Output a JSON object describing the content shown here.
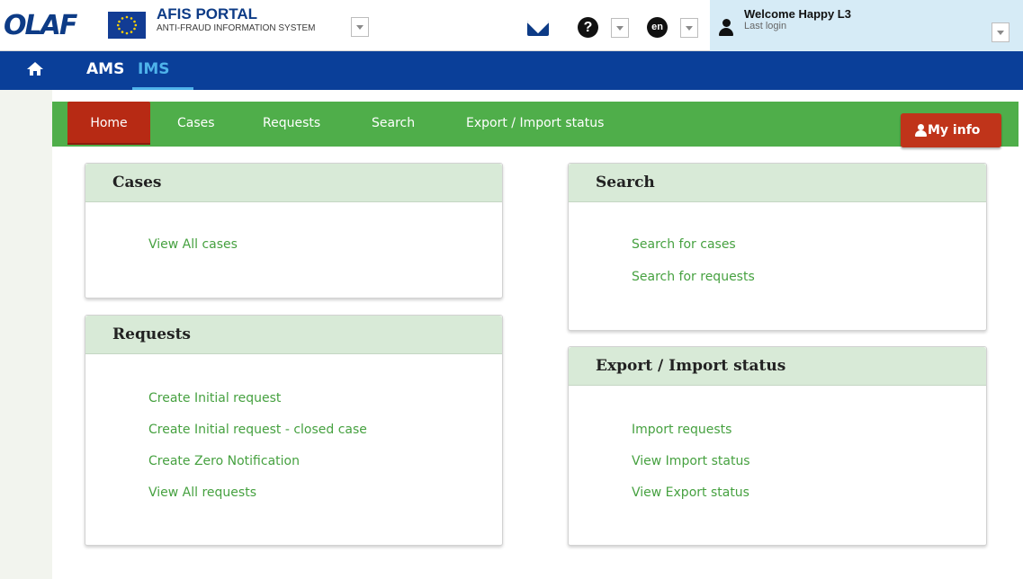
{
  "header": {
    "logo_text": "OLAF",
    "portal_title": "AFIS PORTAL",
    "portal_subtitle": "ANTI-FRAUD INFORMATION SYSTEM",
    "language": "en",
    "help_glyph": "?",
    "welcome": "Welcome Happy L3",
    "last_login": "Last login"
  },
  "icons": {
    "mail": "envelope-icon",
    "help": "question-circle-icon",
    "language": "language-circle-icon",
    "user": "user-icon",
    "home": "home-icon",
    "chevron": "chevron-down-icon"
  },
  "app_nav": {
    "items": [
      "AMS",
      "IMS"
    ],
    "active": "IMS"
  },
  "module_nav": {
    "items": [
      "Home",
      "Cases",
      "Requests",
      "Search",
      "Export / Import status"
    ],
    "active": "Home",
    "my_info": "My info"
  },
  "panels": {
    "cases": {
      "title": "Cases",
      "links": [
        "View All cases"
      ]
    },
    "requests": {
      "title": "Requests",
      "links": [
        "Create Initial request",
        "Create Initial request - closed case",
        "Create Zero Notification",
        "View All requests"
      ]
    },
    "search": {
      "title": "Search",
      "links": [
        "Search for cases",
        "Search for requests"
      ]
    },
    "export": {
      "title": "Export / Import status",
      "links": [
        "Import requests",
        "View Import status",
        "View Export status"
      ]
    }
  },
  "colors": {
    "brand_blue": "#0a3f99",
    "nav_green": "#4fae4a",
    "active_red": "#b72a14",
    "link_green": "#46a140",
    "panel_header": "#d8ead7",
    "ims_highlight": "#4fb3ea"
  }
}
